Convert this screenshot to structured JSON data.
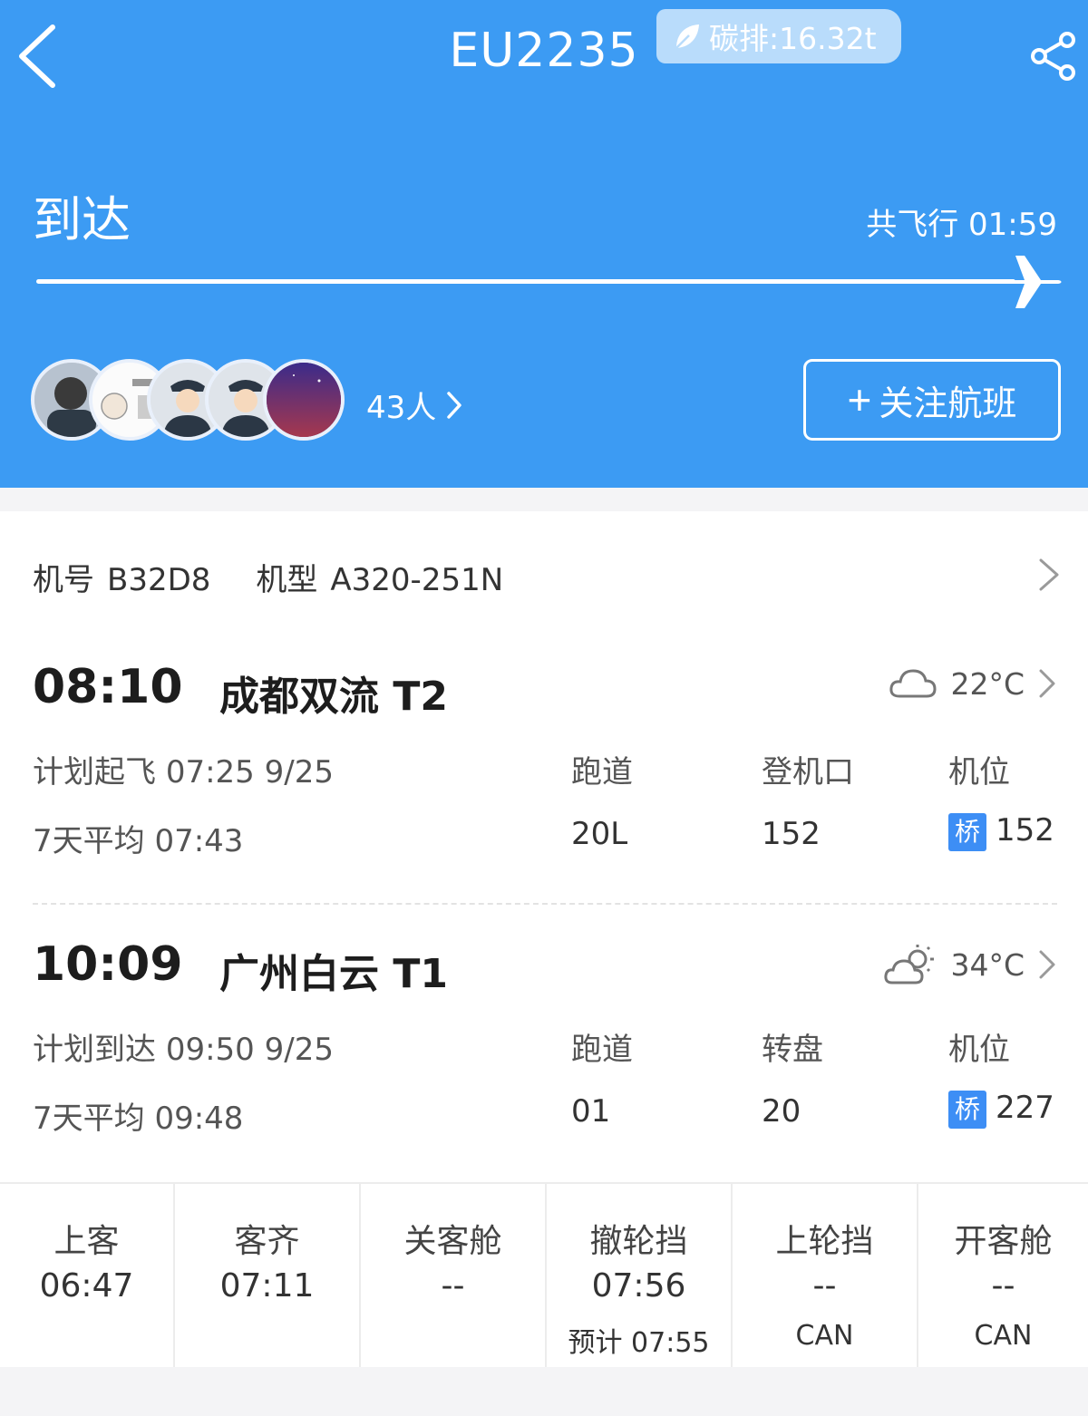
{
  "header": {
    "flight_number": "EU2235",
    "carbon_label": "碳排:16.32t",
    "status": "到达",
    "duration": "共飞行 01:59",
    "followers_count": "43人",
    "follow_button": "关注航班",
    "colors": {
      "background": "#3c9bf3",
      "carbon_badge": "#b9dcfb"
    },
    "icons": [
      "back-arrow-icon",
      "leaf-icon",
      "share-icon",
      "plane-icon",
      "chevron-right-icon",
      "plus-icon"
    ]
  },
  "aircraft": {
    "reg_label": "机号",
    "reg": "B32D8",
    "type_label": "机型",
    "type": "A320-251N"
  },
  "departure": {
    "time": "08:10",
    "airport": "成都双流 T2",
    "weather_icon": "cloudy-icon",
    "temp": "22°C",
    "planned_label": "计划起飞",
    "planned_value": "07:25 9/25",
    "avg_label": "7天平均",
    "avg_value": "07:43",
    "runway_label": "跑道",
    "runway": "20L",
    "gate_label": "登机口",
    "gate": "152",
    "stand_label": "机位",
    "stand_badge": "桥",
    "stand": "152"
  },
  "arrival": {
    "time": "10:09",
    "airport": "广州白云 T1",
    "weather_icon": "partly-sunny-icon",
    "temp": "34°C",
    "planned_label": "计划到达",
    "planned_value": "09:50 9/25",
    "avg_label": "7天平均",
    "avg_value": "09:48",
    "runway_label": "跑道",
    "runway": "01",
    "carousel_label": "转盘",
    "carousel": "20",
    "stand_label": "机位",
    "stand_badge": "桥",
    "stand": "227"
  },
  "timeline": [
    {
      "label": "上客",
      "value": "06:47",
      "sub": ""
    },
    {
      "label": "客齐",
      "value": "07:11",
      "sub": ""
    },
    {
      "label": "关客舱",
      "value": "--",
      "sub": ""
    },
    {
      "label": "撤轮挡",
      "value": "07:56",
      "sub": "预计 07:55"
    },
    {
      "label": "上轮挡",
      "value": "--",
      "sub": "CAN"
    },
    {
      "label": "开客舱",
      "value": "--",
      "sub": "CAN"
    }
  ]
}
